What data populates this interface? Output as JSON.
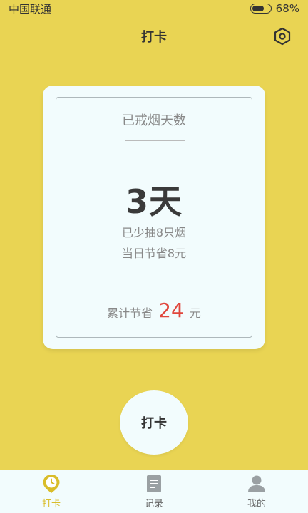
{
  "status_bar": {
    "carrier": "中国联通",
    "battery_percent": "68%",
    "battery_level": 0.68
  },
  "header": {
    "title": "打卡",
    "settings_icon": "settings-hexagon-icon"
  },
  "card": {
    "title": "已戒烟天数",
    "days": "3天",
    "less_smoked": "已少抽8只烟",
    "daily_saving": "当日节省8元",
    "total_label": "累计节省",
    "total_amount": "24",
    "total_unit": "元"
  },
  "checkin_button": {
    "label": "打卡"
  },
  "bottom_nav": {
    "items": [
      {
        "label": "打卡",
        "icon": "clock-pin-icon",
        "active": true
      },
      {
        "label": "记录",
        "icon": "document-icon",
        "active": false
      },
      {
        "label": "我的",
        "icon": "user-icon",
        "active": false
      }
    ]
  },
  "colors": {
    "background": "#e9d453",
    "card": "#f2fcfd",
    "accent_red": "#e0463c",
    "nav_active": "#d9bd2a"
  }
}
